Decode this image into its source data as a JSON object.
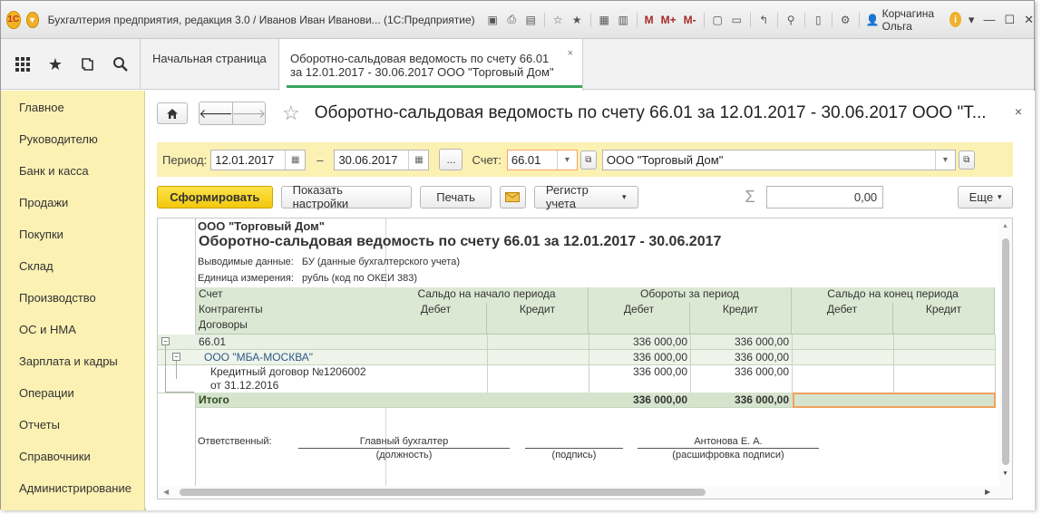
{
  "window": {
    "logo": "1С",
    "title": "Бухгалтерия предприятия, редакция 3.0 / Иванов Иван Иванови... (1С:Предприятие)",
    "toolbar_m": [
      "M",
      "M+",
      "M-"
    ],
    "user": "Корчагина Ольга"
  },
  "tabs": {
    "home": "Начальная страница",
    "active_line1": "Оборотно-сальдовая ведомость по счету 66.01",
    "active_line2": "за 12.01.2017 - 30.06.2017 ООО \"Торговый Дом\"",
    "close": "×"
  },
  "nav": [
    "Главное",
    "Руководителю",
    "Банк и касса",
    "Продажи",
    "Покупки",
    "Склад",
    "Производство",
    "ОС и НМА",
    "Зарплата и кадры",
    "Операции",
    "Отчеты",
    "Справочники",
    "Администрирование"
  ],
  "form": {
    "title": "Оборотно-сальдовая ведомость по счету 66.01 за 12.01.2017 - 30.06.2017 ООО \"Т...",
    "close": "×"
  },
  "period": {
    "label": "Период:",
    "from": "12.01.2017",
    "dash": "–",
    "to": "30.06.2017",
    "dots": "...",
    "account_label": "Счет:",
    "account": "66.01",
    "org": "ООО \"Торговый Дом\""
  },
  "commands": {
    "generate": "Сформировать",
    "settings": "Показать настройки",
    "print": "Печать",
    "register": "Регистр учета",
    "sum_value": "0,00",
    "more": "Еще"
  },
  "report": {
    "org": "ООО \"Торговый Дом\"",
    "title": "Оборотно-сальдовая ведомость по счету 66.01 за 12.01.2017 - 30.06.2017",
    "data_label": "Выводимые данные:",
    "data_value": "БУ (данные бухгалтерского учета)",
    "unit_label": "Единица измерения:",
    "unit_value": "рубль (код по ОКЕИ 383)",
    "hdr_account": "Счет",
    "hdr_contractors": "Контрагенты",
    "hdr_contracts": "Договоры",
    "hdr_open": "Сальдо на начало периода",
    "hdr_turnover": "Обороты за период",
    "hdr_close": "Сальдо на конец периода",
    "debit": "Дебет",
    "credit": "Кредит",
    "rows": [
      {
        "name": "66.01",
        "turn_debit": "336 000,00",
        "turn_credit": "336 000,00"
      },
      {
        "name": "ООО \"МБА-МОСКВА\"",
        "turn_debit": "336 000,00",
        "turn_credit": "336 000,00"
      },
      {
        "name": "Кредитный договор №1206002",
        "name2": "от 31.12.2016",
        "turn_debit": "336 000,00",
        "turn_credit": "336 000,00"
      }
    ],
    "total_label": "Итого",
    "total_debit": "336 000,00",
    "total_credit": "336 000,00",
    "responsible": "Ответственный:",
    "position": "Главный бухгалтер",
    "position_caption": "(должность)",
    "signature_caption": "(подпись)",
    "person": "Антонова Е. А.",
    "person_caption": "(расшифровка подписи)"
  }
}
